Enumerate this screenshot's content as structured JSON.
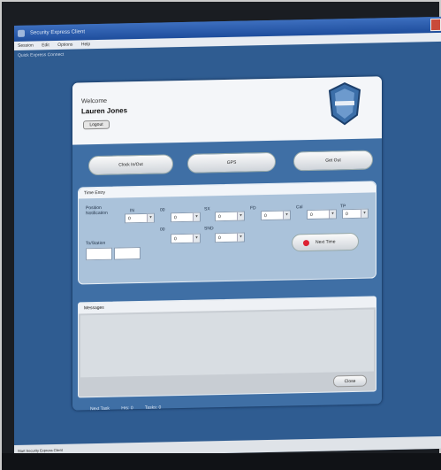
{
  "window": {
    "title": "Security Express Client"
  },
  "menu": {
    "items": [
      "Session",
      "Edit",
      "Options",
      "Help"
    ]
  },
  "subheader": "Quick Express Connect",
  "header": {
    "welcome": "Welcome",
    "user_name": "Lauren Jones",
    "logout_label": "Logout"
  },
  "actions": {
    "clock_in": "Clock In/Out",
    "gps": "GPS",
    "get_out": "Get Out"
  },
  "time_entry": {
    "title": "Time Entry",
    "from_label": "Position Notification",
    "to_label": "To/Station",
    "fields": [
      {
        "label": "IN",
        "value": "0"
      },
      {
        "label": "00",
        "value": "0"
      },
      {
        "label": "SX",
        "value": "0"
      },
      {
        "label": "FD",
        "value": "0"
      },
      {
        "label": "Cal",
        "value": "0"
      },
      {
        "label": "TP",
        "value": "0"
      }
    ],
    "fields_row2": [
      {
        "label": "00",
        "value": "0"
      },
      {
        "label": "SND",
        "value": "0"
      }
    ],
    "next_button": "Next Time"
  },
  "messages": {
    "title": "Messages",
    "close_label": "Close"
  },
  "status": {
    "label": "Next Task",
    "a": "Hrs: 0",
    "b": "Tasks: 0"
  },
  "taskbar": {
    "text": "Start   Security Express Client"
  }
}
